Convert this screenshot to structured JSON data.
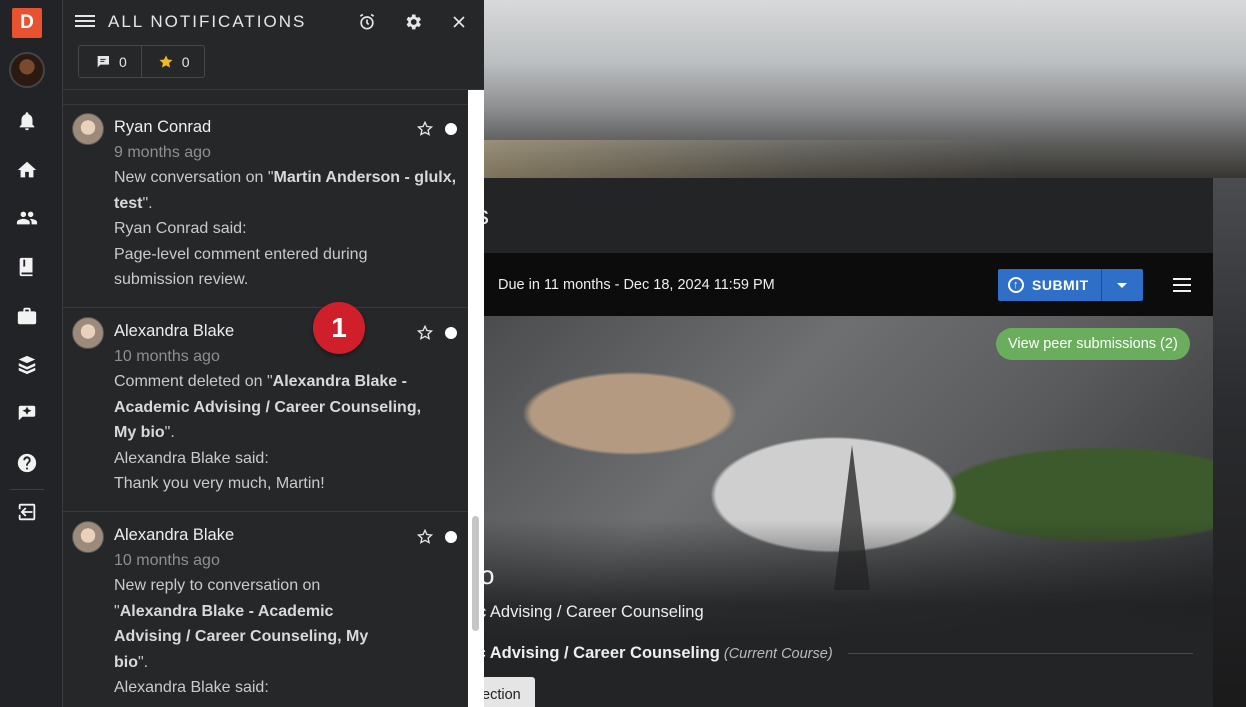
{
  "rail": {
    "logo": "D",
    "icons": [
      "notifications-icon",
      "home-icon",
      "groups-icon",
      "library-icon",
      "portfolio-icon",
      "courses-icon",
      "featured-icon",
      "help-icon",
      "logout-icon"
    ]
  },
  "panel": {
    "title": "ALL NOTIFICATIONS",
    "comment_count": "0",
    "star_count": "0",
    "notifications": [
      {
        "name": "Ryan Conrad",
        "time": "9 months ago",
        "line1_pre": "New conversation on \"",
        "line1_bold": "Martin Anderson - glulx, test",
        "line1_post": "\".",
        "said": "Ryan Conrad said:",
        "message": "Page-level comment entered during submission review."
      },
      {
        "name": "Alexandra Blake",
        "time": "10 months ago",
        "line1_pre": "Comment deleted on \"",
        "line1_bold": "Alexandra Blake - Academic Advising / Career Counseling, My bio",
        "line1_post": "\".",
        "said": "Alexandra Blake said:",
        "message": "Thank you very much, Martin!"
      },
      {
        "name": "Alexandra Blake",
        "time": "10 months ago",
        "line1_pre": "New reply to conversation on \"",
        "line1_bold": "Alexandra Blake - Academic Advising / Career Counseling, My bio",
        "line1_post": "\".",
        "said": "Alexandra Blake said:",
        "message": ""
      }
    ]
  },
  "callout": "1",
  "main": {
    "title_fragment": "s",
    "due": "Due in 11 months - Dec 18, 2024 11:59 PM",
    "submit_label": "SUBMIT",
    "peer_button": "View peer submissions (2)",
    "assignment_fragment": "o",
    "course_fragment": "c Advising / Career Counseling",
    "course_line": "ic Advising / Career Counseling",
    "current_course": "(Current Course)",
    "section_button": "ection"
  },
  "colors": {
    "accent_blue": "#2f6fc7",
    "peer_green": "#6aae5d",
    "callout_red": "#cf1f2b",
    "logo_orange": "#e8522e"
  }
}
